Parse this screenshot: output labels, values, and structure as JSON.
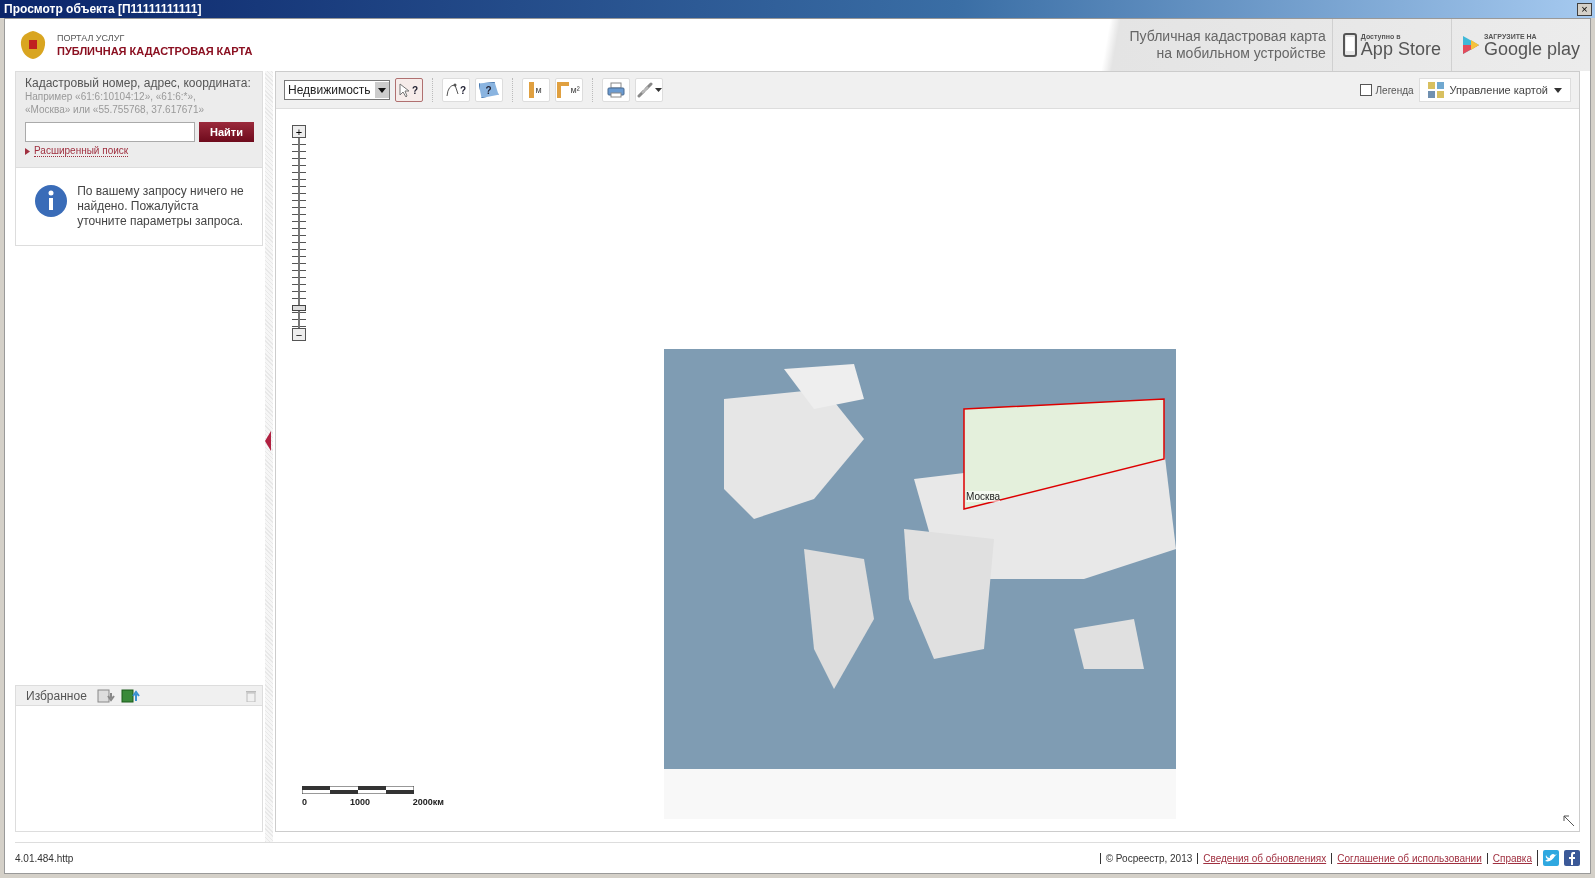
{
  "window": {
    "title": "Просмотр объекта [П11111111111]",
    "close": "×"
  },
  "header": {
    "portal": "ПОРТАЛ УСЛУГ",
    "title": "ПУБЛИЧНАЯ КАДАСТРОВАЯ КАРТА",
    "promo": [
      "Публичная кадастровая карта",
      "на мобильном устройстве"
    ],
    "app_store": {
      "small": "Доступно в",
      "big": "App Store"
    },
    "google_play": {
      "small": "ЗАГРУЗИТЕ НА",
      "big": "Google play"
    }
  },
  "search": {
    "label": "Кадастровый номер, адрес, координата:",
    "hint": [
      "Например «61:6:10104:12», «61:6:*»,",
      "«Москва» или «55.755768, 37.617671»"
    ],
    "button": "Найти",
    "advanced": "Расширенный поиск"
  },
  "message": "По вашему запросу ничего не найдено. Пожалуйста уточните параметры запроса.",
  "favorites": {
    "title": "Избранное"
  },
  "toolbar": {
    "layer": "Недвижимость",
    "tools": [
      {
        "kind": "pointer",
        "label": "?",
        "selected": true
      },
      {
        "kind": "line-query",
        "label": "?",
        "selected": false
      },
      {
        "kind": "area-query",
        "label": "?",
        "selected": false
      },
      {
        "kind": "measure-length",
        "label": "м",
        "selected": false
      },
      {
        "kind": "measure-area",
        "label": "м²",
        "selected": false
      },
      {
        "kind": "print",
        "selected": false
      },
      {
        "kind": "link",
        "selected": false
      }
    ],
    "legend": {
      "label": "Легенда",
      "checked": false
    },
    "map_control": "Управление картой"
  },
  "map": {
    "zoom": {
      "level": 0.08,
      "in": "+",
      "out": "−"
    },
    "city": "Москва",
    "scale": [
      "0",
      "1000",
      "2000км"
    ]
  },
  "footer": {
    "version": "4.01.484.http",
    "copyright": "© Росреестр, 2013",
    "links": [
      "Сведения об обновлениях",
      "Соглашение об использовании",
      "Справка"
    ]
  }
}
